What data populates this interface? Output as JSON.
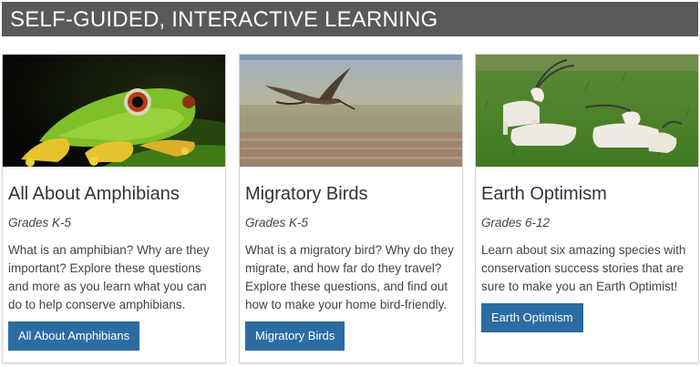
{
  "banner": {
    "title": "SELF-GUIDED, INTERACTIVE LEARNING",
    "background": "#58595b"
  },
  "cards": [
    {
      "image": "tree-frog-photo",
      "title": "All About Amphibians",
      "grades": "Grades K-5",
      "description": "What is an amphibian? Why are they important? Explore these questions and more as you learn what you can do to help conserve amphibians.",
      "button_label": "All About Amphibians"
    },
    {
      "image": "flying-bird-photo",
      "title": "Migratory Birds",
      "grades": "Grades K-5",
      "description": "What is a migratory bird? Why do they migrate, and how far do they travel? Explore these questions, and find out how to make your home bird-friendly.",
      "button_label": "Migratory Birds"
    },
    {
      "image": "oryx-photo",
      "title": "Earth Optimism",
      "grades": "Grades 6-12",
      "description": "Learn about six amazing species with conservation success stories that are sure to make you an Earth Optimist!",
      "button_label": "Earth Optimism"
    }
  ],
  "colors": {
    "button": "#2b6ca3",
    "text": "#444444",
    "title": "#333333"
  }
}
